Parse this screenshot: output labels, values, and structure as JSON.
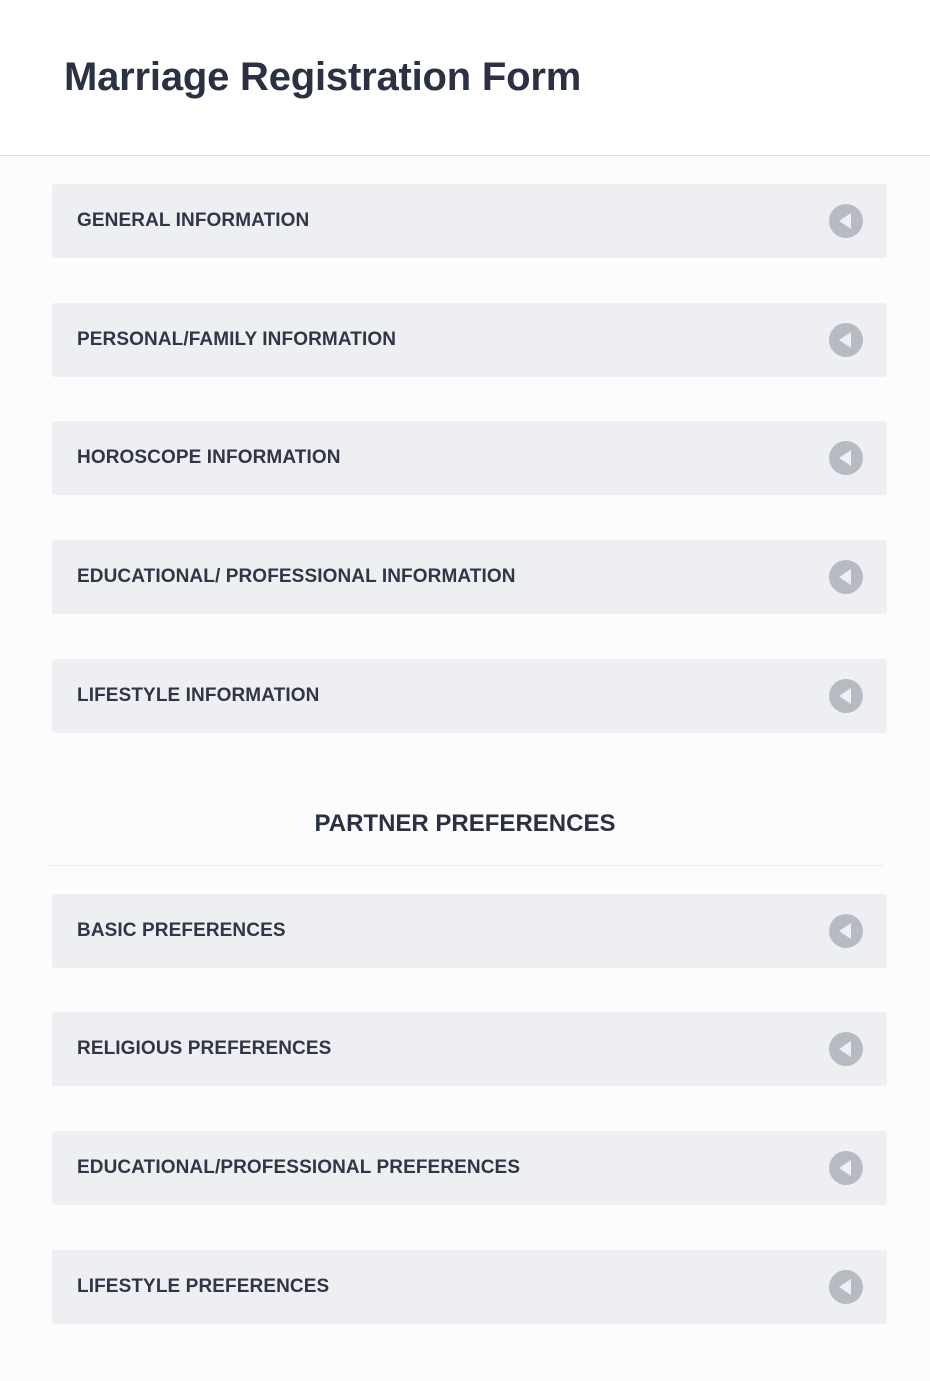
{
  "page": {
    "title": "Marriage Registration Form"
  },
  "profile_sections": [
    {
      "label": "GENERAL INFORMATION",
      "icon": "collapse-arrow-icon"
    },
    {
      "label": "PERSONAL/FAMILY INFORMATION",
      "icon": "collapse-arrow-icon"
    },
    {
      "label": "HOROSCOPE INFORMATION",
      "icon": "collapse-arrow-icon"
    },
    {
      "label": "EDUCATIONAL/ PROFESSIONAL INFORMATION",
      "icon": "collapse-arrow-icon"
    },
    {
      "label": "LIFESTYLE INFORMATION",
      "icon": "collapse-arrow-icon"
    }
  ],
  "partner_preferences": {
    "heading": "PARTNER PREFERENCES",
    "sections": [
      {
        "label": "BASIC PREFERENCES",
        "icon": "collapse-arrow-icon"
      },
      {
        "label": "RELIGIOUS PREFERENCES",
        "icon": "collapse-arrow-icon"
      },
      {
        "label": "EDUCATIONAL/PROFESSIONAL PREFERENCES",
        "icon": "collapse-arrow-icon"
      },
      {
        "label": "LIFESTYLE PREFERENCES",
        "icon": "collapse-arrow-icon"
      }
    ]
  },
  "colors": {
    "text": "#2a3142",
    "panel_background": "#eeeff2",
    "icon": "#b6bac3"
  }
}
